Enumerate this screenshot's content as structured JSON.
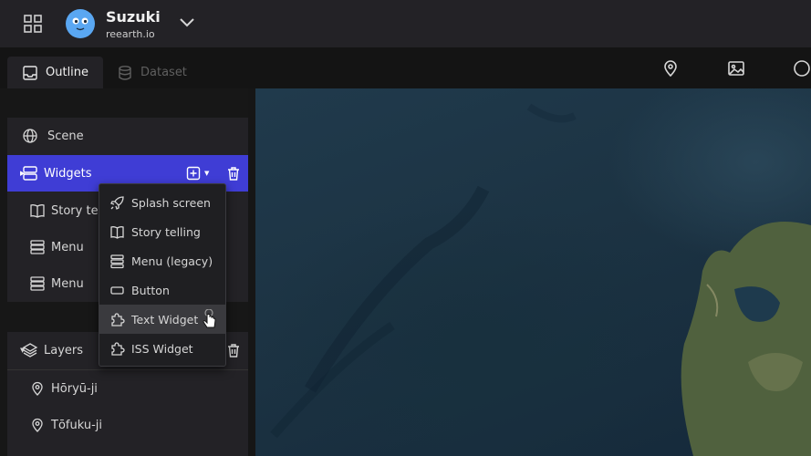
{
  "header": {
    "workspace_name": "Suzuki",
    "workspace_domain": "reearth.io"
  },
  "tabs": [
    {
      "label": "Outline",
      "active": true,
      "icon": "inbox-icon"
    },
    {
      "label": "Dataset",
      "active": false,
      "icon": "database-icon"
    }
  ],
  "toolbar": {
    "icons": [
      "map-pin-icon",
      "image-icon",
      "circle-icon"
    ]
  },
  "outline": {
    "scene_label": "Scene",
    "widgets": {
      "label": "Widgets",
      "items": [
        {
          "label": "Story telling",
          "icon": "book-icon"
        },
        {
          "label": "Menu",
          "icon": "menu-icon"
        },
        {
          "label": "Menu",
          "icon": "menu-icon"
        }
      ]
    },
    "layers": {
      "label": "Layers",
      "items": [
        {
          "label": "Hōryū-ji",
          "icon": "map-pin-icon"
        },
        {
          "label": "Tōfuku-ji",
          "icon": "map-pin-icon"
        }
      ]
    }
  },
  "add_widget_menu": {
    "items": [
      {
        "label": "Splash screen",
        "icon": "rocket-icon"
      },
      {
        "label": "Story telling",
        "icon": "book-icon"
      },
      {
        "label": "Menu (legacy)",
        "icon": "menu-icon"
      },
      {
        "label": "Button",
        "icon": "button-icon"
      },
      {
        "label": "Text Widget",
        "icon": "puzzle-icon",
        "hovered": true
      },
      {
        "label": "ISS Widget",
        "icon": "puzzle-icon"
      }
    ]
  },
  "colors": {
    "accent": "#3f3dd5",
    "panel": "#232226",
    "background": "#161616"
  }
}
